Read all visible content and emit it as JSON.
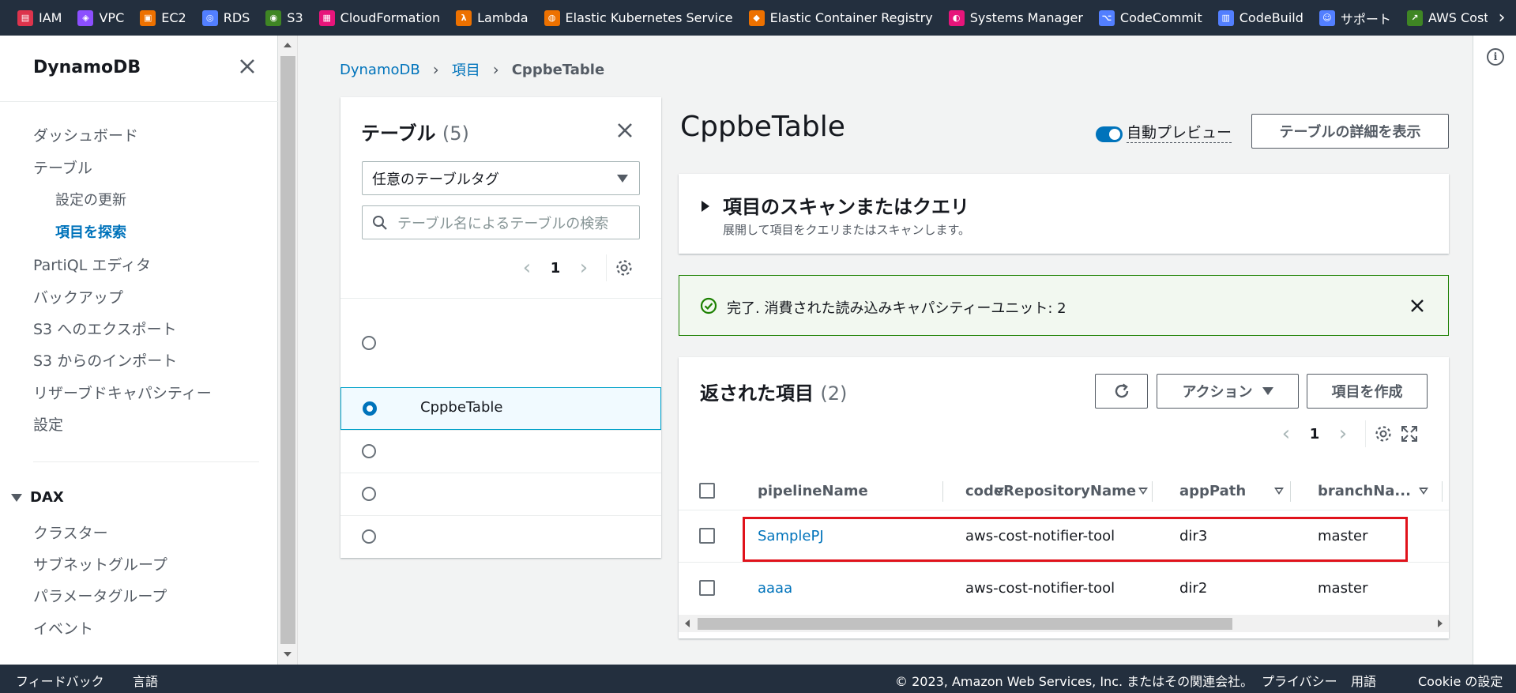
{
  "services": [
    {
      "label": "IAM",
      "color": "#dd344c"
    },
    {
      "label": "VPC",
      "color": "#8c4fff"
    },
    {
      "label": "EC2",
      "color": "#ed7100"
    },
    {
      "label": "RDS",
      "color": "#527fff"
    },
    {
      "label": "S3",
      "color": "#3f8624"
    },
    {
      "label": "CloudFormation",
      "color": "#e7157b"
    },
    {
      "label": "Lambda",
      "color": "#ed7100"
    },
    {
      "label": "Elastic Kubernetes Service",
      "color": "#ed7100"
    },
    {
      "label": "Elastic Container Registry",
      "color": "#ed7100"
    },
    {
      "label": "Systems Manager",
      "color": "#e7157b"
    },
    {
      "label": "CodeCommit",
      "color": "#527fff"
    },
    {
      "label": "CodeBuild",
      "color": "#527fff"
    },
    {
      "label": "サポート",
      "color": "#527fff"
    },
    {
      "label": "AWS Cost Exp",
      "color": "#3f8624"
    }
  ],
  "sidenav": {
    "title": "DynamoDB",
    "items": {
      "dashboard": "ダッシュボード",
      "tables": "テーブル",
      "update_settings": "設定の更新",
      "explore_items": "項目を探索",
      "partiql": "PartiQL エディタ",
      "backups": "バックアップ",
      "export_s3": "S3 へのエクスポート",
      "import_s3": "S3 からのインポート",
      "reserved": "リザーブドキャパシティー",
      "settings": "設定"
    },
    "dax": {
      "label": "DAX",
      "items": [
        "クラスター",
        "サブネットグループ",
        "パラメータグループ",
        "イベント"
      ]
    }
  },
  "breadcrumb": {
    "root": "DynamoDB",
    "mid": "項目",
    "current": "CppbeTable"
  },
  "tables_panel": {
    "title": "テーブル",
    "count": "(5)",
    "tag_select": "任意のテーブルタグ",
    "search_placeholder": "テーブル名によるテーブルの検索",
    "page": "1",
    "selected_table": "CppbeTable"
  },
  "main": {
    "title": "CppbeTable",
    "auto_preview": "自動プレビュー",
    "view_details": "テーブルの詳細を表示",
    "scan": {
      "title": "項目のスキャンまたはクエリ",
      "desc": "展開して項目をクエリまたはスキャンします。"
    },
    "flash": "完了. 消費された読み込みキャパシティーユニット: 2",
    "results": {
      "title": "返された項目",
      "count": "(2)",
      "actions": "アクション",
      "create": "項目を作成",
      "page": "1",
      "columns": [
        "pipelineName",
        "codeRepositoryName",
        "appPath",
        "branchNa..."
      ],
      "rows": [
        [
          "SamplePJ",
          "aws-cost-notifier-tool",
          "dir3",
          "master"
        ],
        [
          "aaaa",
          "aws-cost-notifier-tool",
          "dir2",
          "master"
        ]
      ]
    }
  },
  "footer": {
    "feedback": "フィードバック",
    "language": "言語",
    "copyright": "© 2023, Amazon Web Services, Inc. またはその関連会社。",
    "privacy": "プライバシー",
    "terms": "用語",
    "cookie": "Cookie の設定"
  },
  "colors": {
    "accent": "#0073bb",
    "header": "#232f3e",
    "success": "#1d8102",
    "highlight": "#e0121b"
  }
}
